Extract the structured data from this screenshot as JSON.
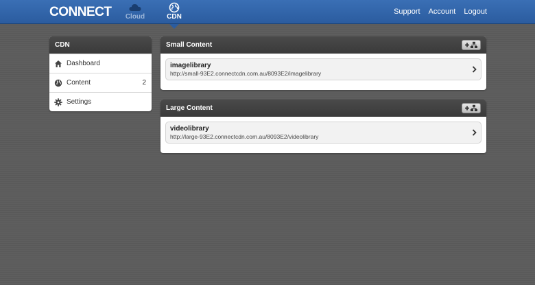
{
  "header": {
    "logo": "CONNECT",
    "tabs": [
      {
        "label": "Cloud",
        "icon": "cloud-icon"
      },
      {
        "label": "CDN",
        "icon": "globe-icon"
      }
    ],
    "links": [
      "Support",
      "Account",
      "Logout"
    ]
  },
  "sidebar": {
    "title": "CDN",
    "items": [
      {
        "label": "Dashboard",
        "icon": "home-icon",
        "count": ""
      },
      {
        "label": "Content",
        "icon": "globe-icon",
        "count": "2"
      },
      {
        "label": "Settings",
        "icon": "gear-icon",
        "count": ""
      }
    ]
  },
  "panels": [
    {
      "title": "Small Content",
      "items": [
        {
          "name": "imagelibrary",
          "url": "http://small-93E2.connectcdn.com.au/8093E2/imagelibrary"
        }
      ]
    },
    {
      "title": "Large Content",
      "items": [
        {
          "name": "videolibrary",
          "url": "http://large-93E2.connectcdn.com.au/8093E2/videolibrary"
        }
      ]
    }
  ],
  "colors": {
    "topbar": "#2b5c9f",
    "background": "#5e5e5e",
    "panel_header": "#3a3a3a"
  }
}
